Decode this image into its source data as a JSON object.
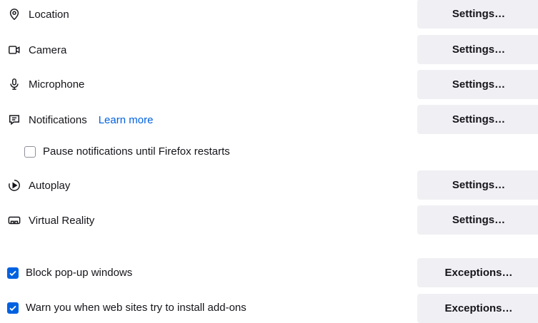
{
  "permissions": [
    {
      "label": "Location",
      "button": "Settings…"
    },
    {
      "label": "Camera",
      "button": "Settings…"
    },
    {
      "label": "Microphone",
      "button": "Settings…"
    },
    {
      "label": "Notifications",
      "learn_more": "Learn more",
      "button": "Settings…"
    },
    {
      "label": "Autoplay",
      "button": "Settings…"
    },
    {
      "label": "Virtual Reality",
      "button": "Settings…"
    }
  ],
  "pause_notifications": {
    "label": "Pause notifications until Firefox restarts",
    "checked": false
  },
  "block_popups": {
    "label": "Block pop-up windows",
    "checked": true,
    "button": "Exceptions…"
  },
  "warn_addons": {
    "label": "Warn you when web sites try to install add-ons",
    "checked": true,
    "button": "Exceptions…"
  },
  "colors": {
    "accent": "#0061e0",
    "button_bg": "#f0f0f4",
    "text": "#15141a"
  },
  "icons": [
    "location-icon",
    "camera-icon",
    "microphone-icon",
    "notifications-icon",
    "autoplay-icon",
    "virtual-reality-icon"
  ]
}
